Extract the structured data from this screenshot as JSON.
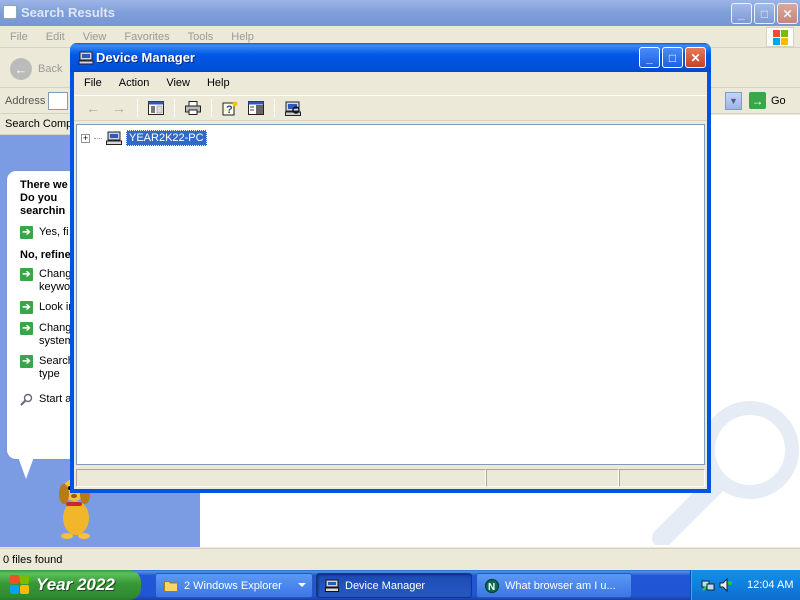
{
  "background_window": {
    "title": "Search Results",
    "menu": [
      "File",
      "Edit",
      "View",
      "Favorites",
      "Tools",
      "Help"
    ],
    "back_label": "Back",
    "address_label": "Address",
    "go_label": "Go",
    "search_companion_label": "Search Compa",
    "assistant": {
      "question": "There we\nDo you\nsearchin",
      "yes_item": "Yes, fi",
      "refine_header": "No, refine",
      "items": [
        "Chang\nkeywo",
        "Look in",
        "Chang\nsystem",
        "Search\ntype"
      ],
      "start_item": "Start a"
    },
    "status_text": "0 files found"
  },
  "device_manager": {
    "title": "Device Manager",
    "menu": [
      "File",
      "Action",
      "View",
      "Help"
    ],
    "tree_root_label": "YEAR2K22-PC",
    "tree_root_expander": "+"
  },
  "taskbar": {
    "start_label": "Year 2022",
    "tasks": [
      {
        "label": "2 Windows Explorer"
      },
      {
        "label": "Device Manager"
      },
      {
        "label": "What browser am I u..."
      }
    ],
    "clock": "12:04 AM"
  },
  "colors": {
    "xp_blue_title": "#0054e3",
    "selection": "#316ac5",
    "start_green": "#379837",
    "taskbar_blue": "#2055d3",
    "tray_blue": "#0f80de"
  }
}
